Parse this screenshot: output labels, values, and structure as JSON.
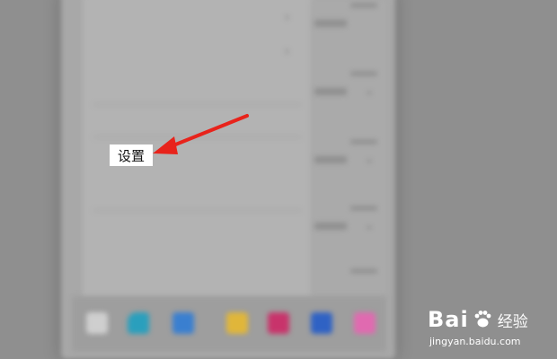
{
  "menu": {
    "highlighted_label": "设置",
    "items": [
      {
        "label": "",
        "has_chevron": true
      },
      {
        "label": "",
        "has_chevron": true
      },
      {
        "label": "",
        "has_chevron": false
      },
      {
        "label": "",
        "has_chevron": false
      },
      {
        "label": "设置",
        "has_chevron": false
      },
      {
        "label": "",
        "has_chevron": false
      },
      {
        "label": "",
        "has_chevron": false
      },
      {
        "label": "",
        "has_chevron": false
      }
    ]
  },
  "annotation": {
    "arrow_color": "#e8231b"
  },
  "taskbar": {
    "icons": [
      "start-icon",
      "edge-icon",
      "store-icon",
      "folder-icon",
      "app-icon",
      "word-icon",
      "paint-icon"
    ]
  },
  "watermark": {
    "brand": "Bai",
    "suffix": "经验",
    "url": "jingyan.baidu.com"
  },
  "colors": {
    "highlight_bg": "#ffffff",
    "arrow": "#e8231b"
  }
}
